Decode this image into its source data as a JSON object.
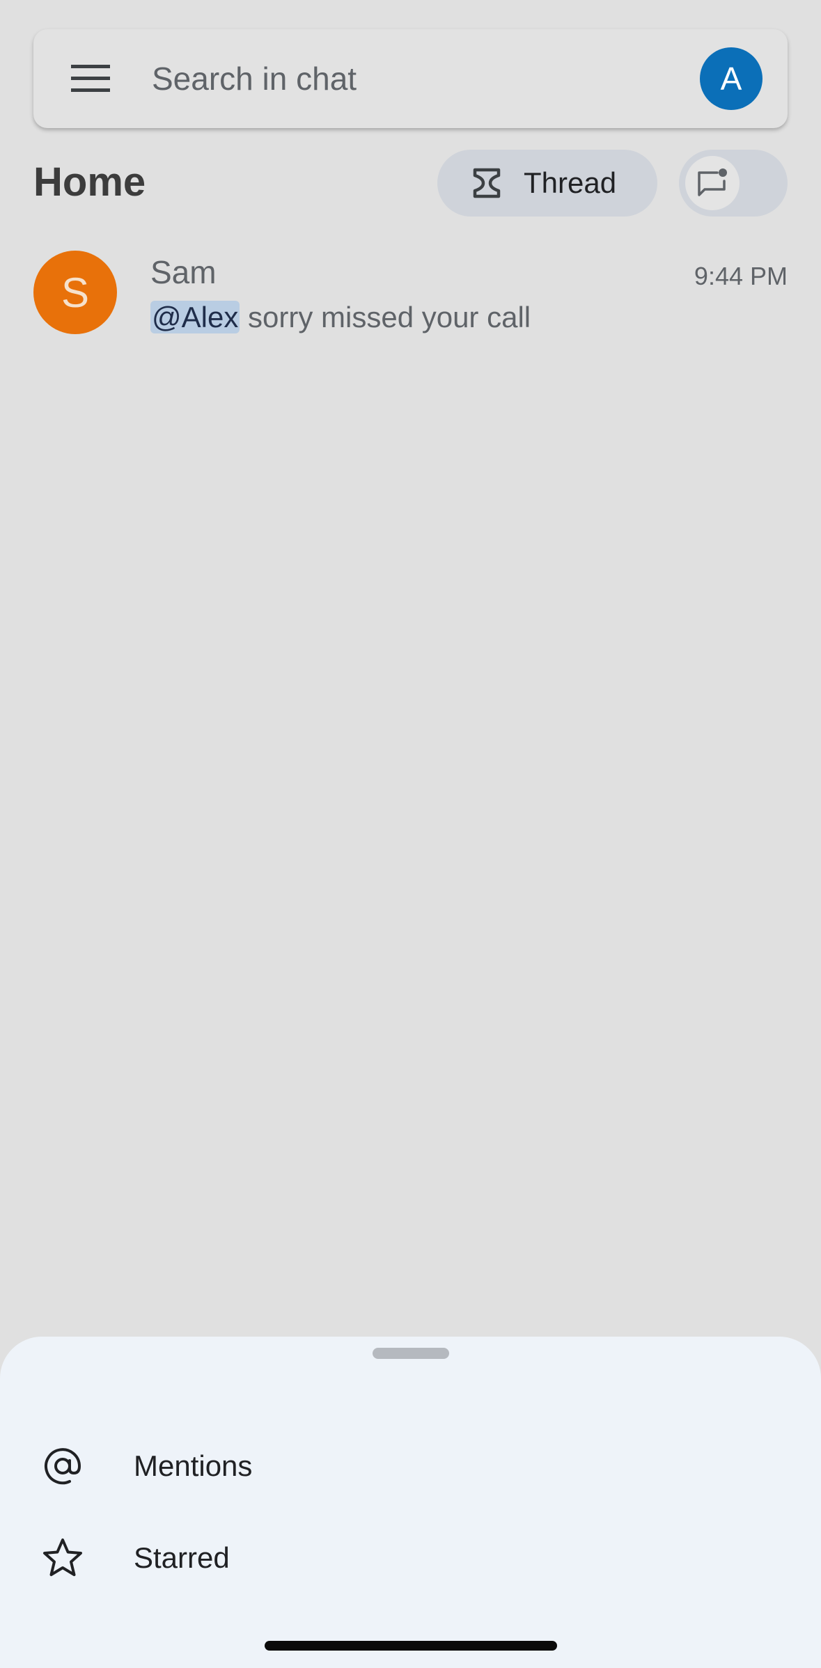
{
  "search": {
    "placeholder": "Search in chat",
    "account_initial": "A",
    "account_color": "#0b6fb8"
  },
  "header": {
    "title": "Home",
    "thread_chip_label": "Thread"
  },
  "conversations": [
    {
      "avatar_initial": "S",
      "avatar_color": "#e8710a",
      "name": "Sam",
      "time": "9:44 PM",
      "mention": "@Alex",
      "message": " sorry missed your call"
    }
  ],
  "sheet": {
    "items": [
      {
        "label": "Mentions",
        "icon": "at-sign-icon"
      },
      {
        "label": "Starred",
        "icon": "star-icon"
      }
    ]
  }
}
